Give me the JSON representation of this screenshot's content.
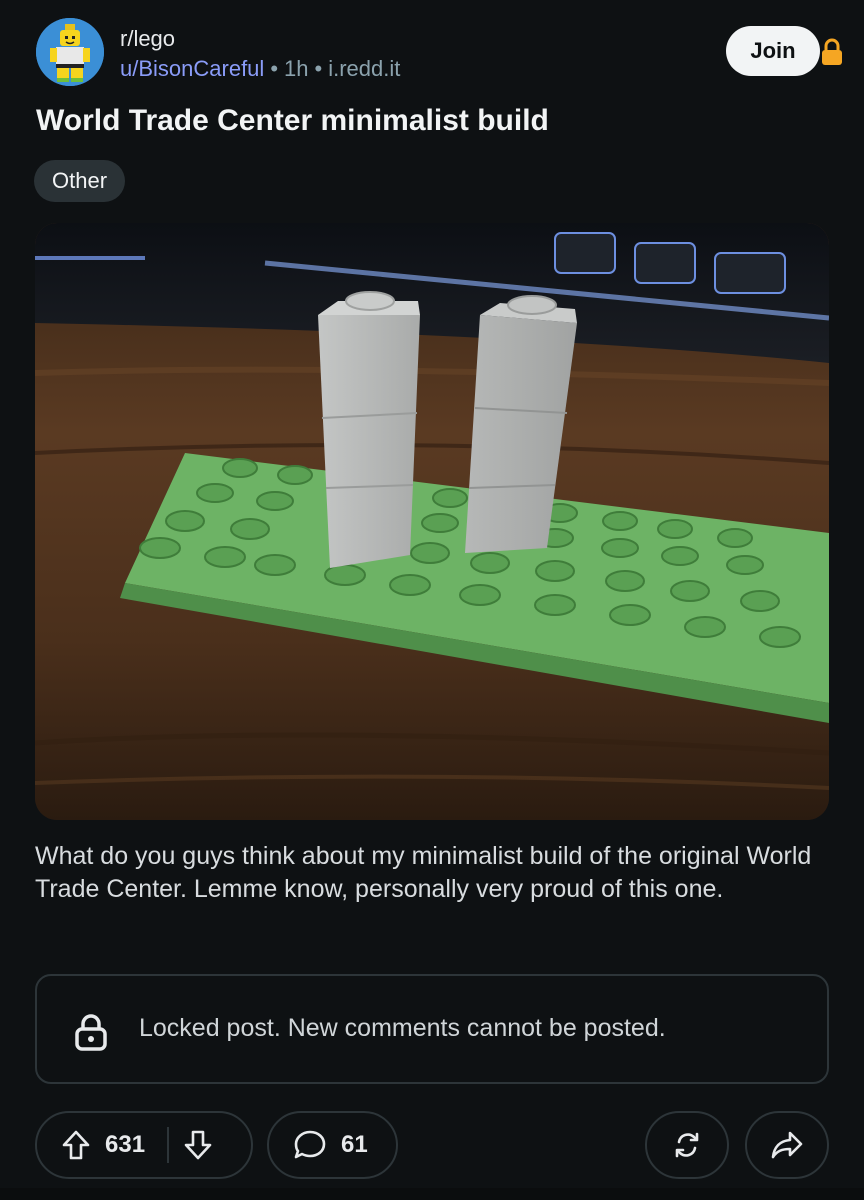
{
  "post": {
    "subreddit": "r/lego",
    "author": "u/BisonCareful",
    "age": "1h",
    "domain": "i.redd.it",
    "join_label": "Join",
    "title": "World Trade Center minimalist build",
    "flair": "Other",
    "body": "What do you guys think about my minimalist build of the original World Trade Center. Lemme know, personally very proud of this one."
  },
  "locked": {
    "message": "Locked post. New comments cannot be posted."
  },
  "actions": {
    "upvotes": "631",
    "comments": "61"
  },
  "icons": {
    "avatar": "lego-minifigure-icon",
    "join_lock": "lock-icon",
    "locked": "lock-icon",
    "upvote": "arrow-up-icon",
    "downvote": "arrow-down-icon",
    "comment": "speech-bubble-icon",
    "award": "repost-icon",
    "share": "share-arrow-icon"
  },
  "colors": {
    "background": "#0e1113",
    "author": "#8a9cf8",
    "lock_accent": "#f5a623",
    "baseplate": "#5fa35a",
    "brick": "#b7b9b8"
  }
}
